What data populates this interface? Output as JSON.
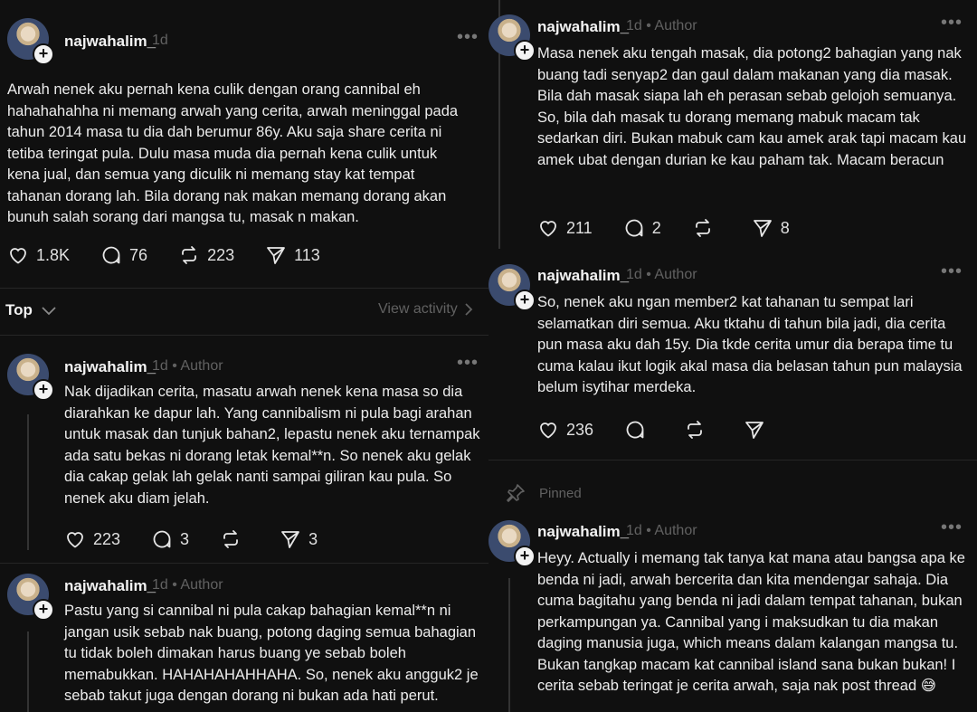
{
  "left": {
    "post1": {
      "username": "najwahalim_",
      "time": "1d",
      "text": "Arwah nenek aku pernah kena culik dengan orang cannibal eh hahahahahha ni memang arwah yang cerita, arwah meninggal pada tahun 2014 masa tu dia dah berumur 86y. Aku saja share cerita ni tetiba teringat pula. Dulu masa muda dia pernah kena culik untuk kena jual, dan semua yang diculik ni memang stay kat tempat tahanan dorang lah. Bila dorang nak makan memang dorang akan bunuh salah sorang dari mangsa tu, masak n makan.",
      "likes": "1.8K",
      "replies": "76",
      "reposts": "223",
      "shares": "113"
    },
    "sort": {
      "label": "Top",
      "view_activity": "View activity"
    },
    "reply1": {
      "username": "najwahalim_",
      "time": "1d",
      "author": "Author",
      "text": "Nak dijadikan cerita, masatu arwah nenek kena masa so dia diarahkan ke dapur lah. Yang cannibalism ni pula bagi arahan untuk masak dan tunjuk bahan2, lepastu nenek aku ternampak ada satu bekas ni dorang letak kemal**n. So nenek aku gelak dia cakap gelak lah gelak nanti sampai giliran kau pula. So nenek aku diam jelah.",
      "likes": "223",
      "replies": "3",
      "shares": "3"
    },
    "reply2": {
      "username": "najwahalim_",
      "time": "1d",
      "author": "Author",
      "text": "Pastu yang si cannibal ni pula cakap bahagian kemal**n ni jangan usik sebab nak buang, potong daging semua bahagian tu tidak boleh dimakan harus buang ye sebab boleh memabukkan. HAHAHAHAHHAHA. So, nenek aku angguk2 je sebab takut juga dengan dorang ni bukan ada hati perut."
    }
  },
  "right": {
    "reply3": {
      "username": "najwahalim_",
      "time": "1d",
      "author": "Author",
      "text": "Masa nenek aku tengah masak, dia potong2 bahagian yang nak buang tadi senyap2 dan gaul dalam makanan yang dia masak. Bila dah masak siapa lah eh perasan sebab gelojoh semuanya. So, bila dah masak tu dorang memang mabuk macam tak sedarkan diri. Bukan mabuk cam kau amek arak tapi macam kau amek ubat dengan durian ke kau paham tak. Macam beracun",
      "likes": "211",
      "replies": "2",
      "shares": "8"
    },
    "reply4": {
      "username": "najwahalim_",
      "time": "1d",
      "author": "Author",
      "text": "So, nenek aku ngan member2 kat tahanan tu sempat lari selamatkan diri semua. Aku tktahu di tahun bila jadi, dia cerita pun masa aku dah 15y. Dia tkde cerita umur dia berapa time tu cuma kalau ikut logik akal masa dia belasan tahun pun malaysia belum isytihar merdeka.",
      "likes": "236"
    },
    "pinned_label": "Pinned",
    "reply5": {
      "username": "najwahalim_",
      "time": "1d",
      "author": "Author",
      "text": "Heyy. Actually i memang tak tanya kat mana atau bangsa apa ke benda ni jadi, arwah bercerita dan kita mendengar sahaja. Dia cuma bagitahu yang benda ni jadi dalam tempat tahanan, bukan perkampungan ya. Cannibal yang i maksudkan tu dia makan daging manusia juga, which means dalam kalangan mangsa tu. Bukan tangkap macam kat cannibal island sana bukan bukan! I cerita sebab teringat je cerita arwah, saja nak post thread 😅"
    }
  },
  "colors": {
    "background": "#101010",
    "text": "#f3f3f3",
    "secondary": "#616161",
    "divider": "#262626"
  },
  "icons": [
    "heart-icon",
    "comment-icon",
    "repost-icon",
    "share-icon",
    "more-icon",
    "plus-icon",
    "pin-icon",
    "chevron-down-icon",
    "chevron-right-icon"
  ]
}
